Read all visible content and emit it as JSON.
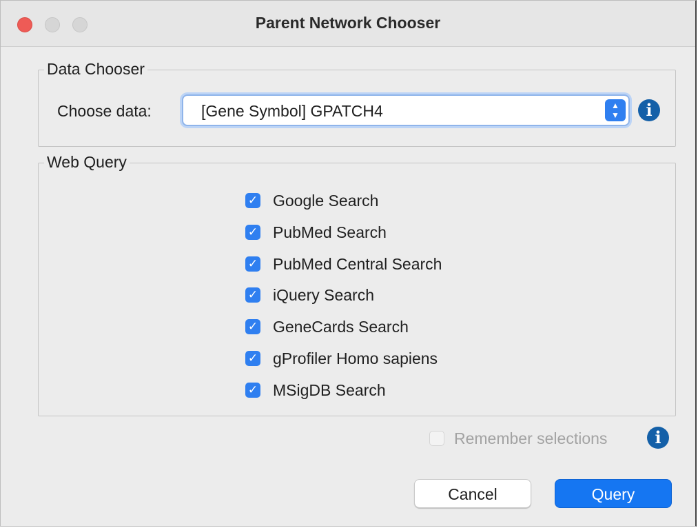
{
  "window": {
    "title": "Parent Network Chooser"
  },
  "data_chooser": {
    "legend": "Data Chooser",
    "label": "Choose data:",
    "selected_value": "[Gene Symbol]  GPATCH4",
    "info_glyph": "i"
  },
  "web_query": {
    "legend": "Web Query",
    "options": [
      {
        "label": "Google Search",
        "checked": true
      },
      {
        "label": "PubMed Search",
        "checked": true
      },
      {
        "label": "PubMed Central Search",
        "checked": true
      },
      {
        "label": "iQuery Search",
        "checked": true
      },
      {
        "label": "GeneCards Search",
        "checked": true
      },
      {
        "label": "gProfiler Homo sapiens",
        "checked": true
      },
      {
        "label": "MSigDB Search",
        "checked": true
      }
    ]
  },
  "remember": {
    "label": "Remember selections",
    "checked": false,
    "info_glyph": "i"
  },
  "buttons": {
    "cancel": "Cancel",
    "query": "Query"
  },
  "colors": {
    "accent": "#2f7ff0",
    "info": "#1460a8",
    "close": "#ee5b56"
  }
}
